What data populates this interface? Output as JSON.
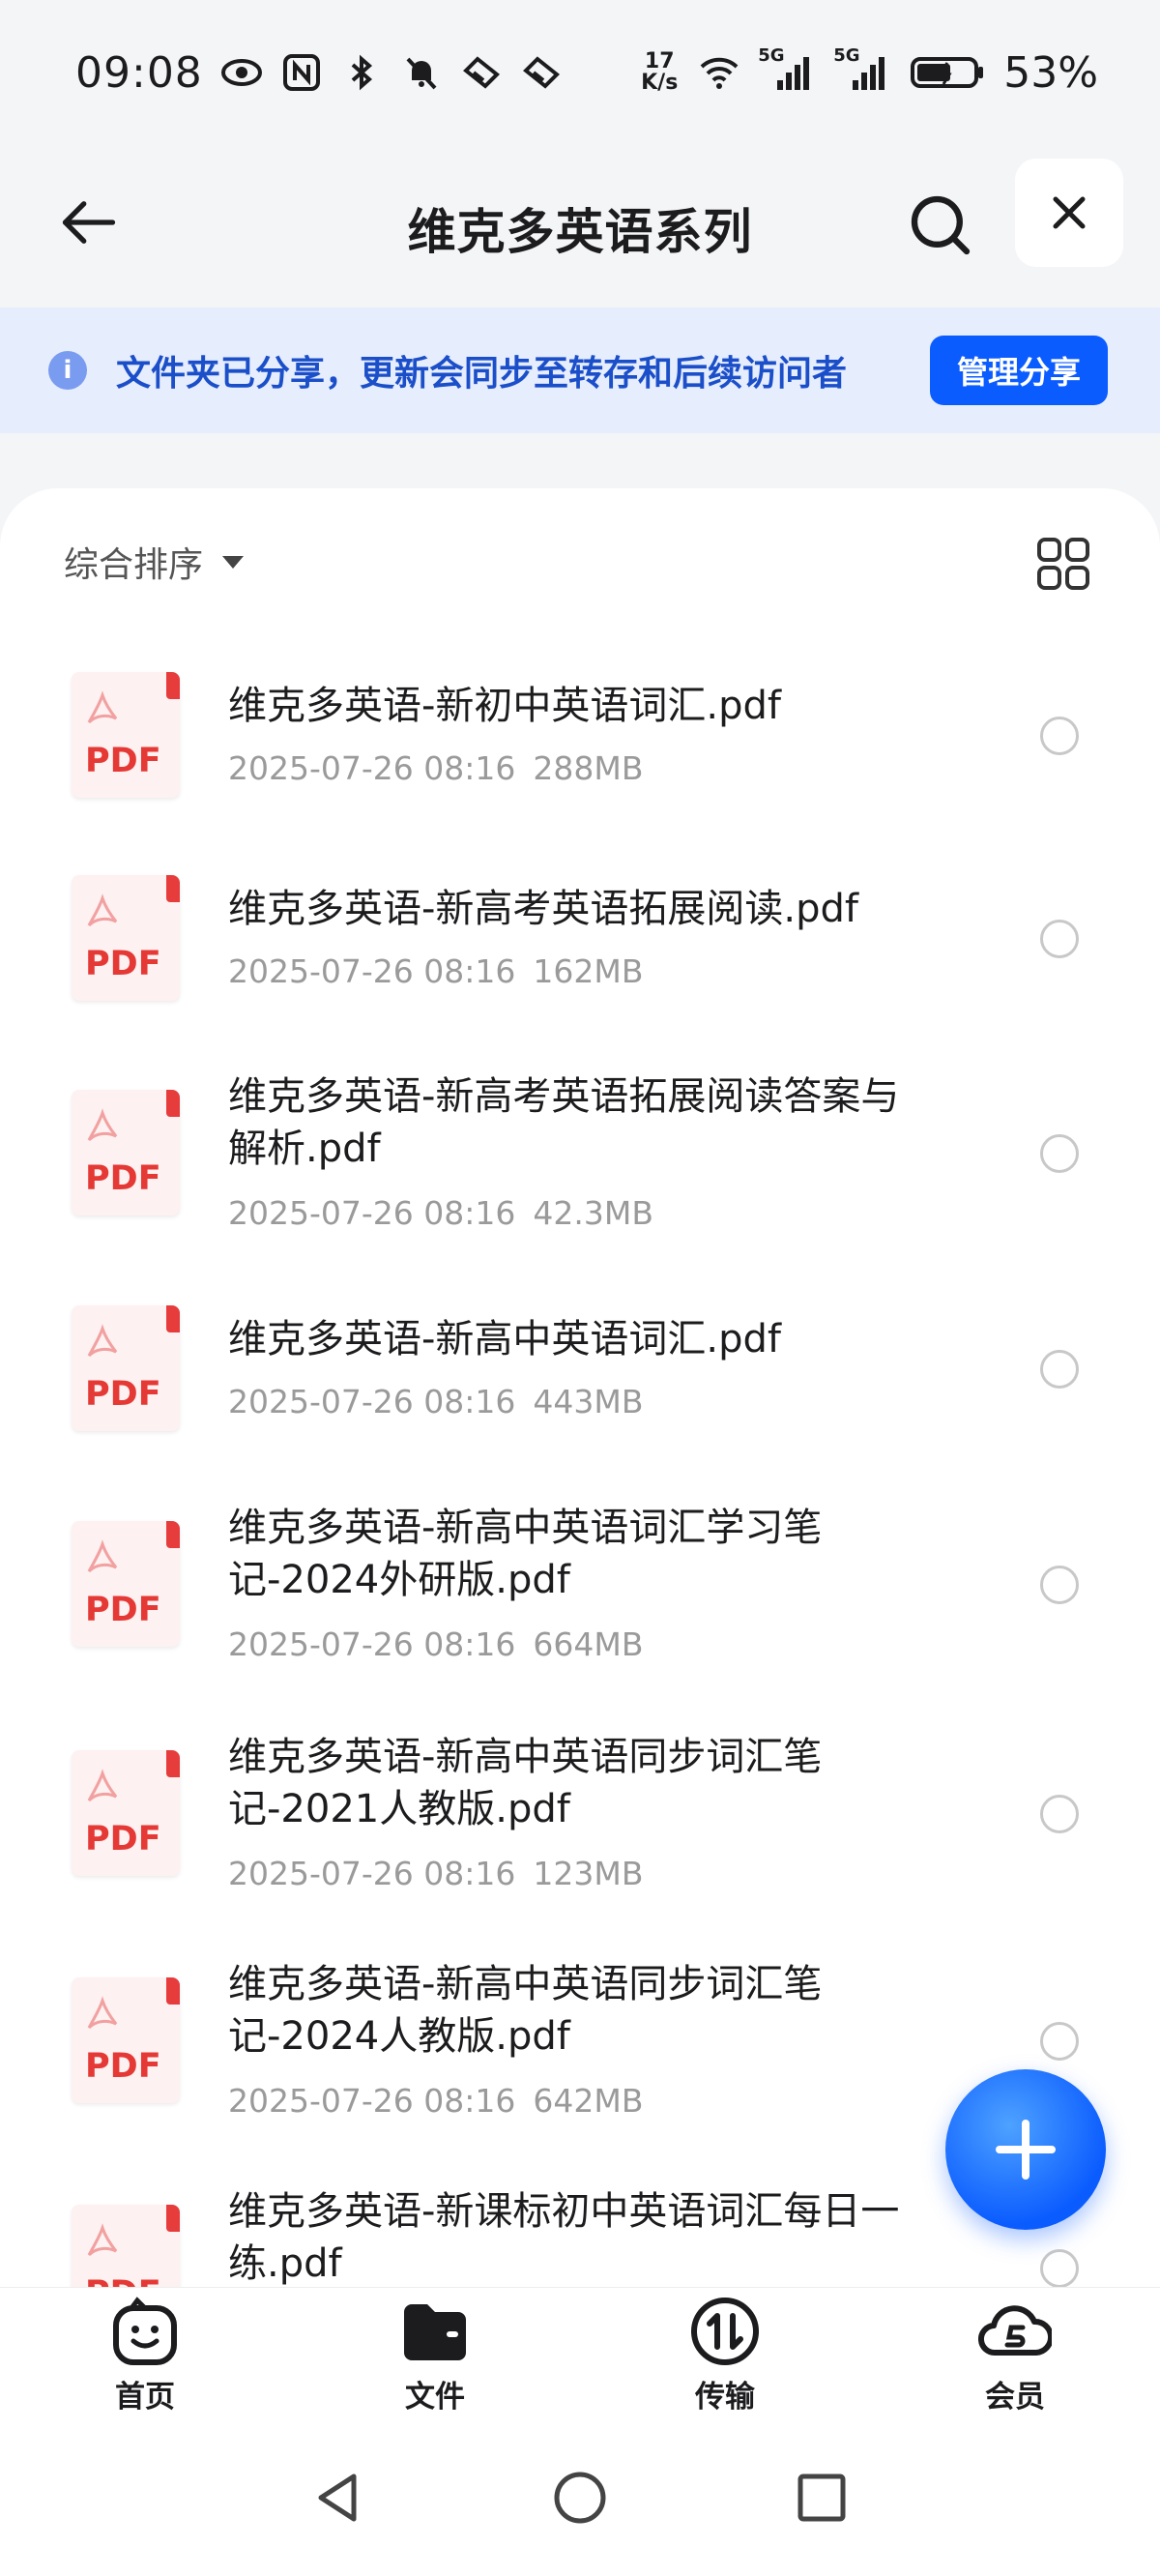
{
  "status_bar": {
    "time": "09:08",
    "net_speed_top": "17",
    "net_speed_bottom": "K/s",
    "network_1": "5G",
    "network_2": "5G",
    "battery": "53%",
    "icons": [
      "eye-icon",
      "nfc-icon",
      "bluetooth-icon",
      "mute-icon",
      "app-icon",
      "app-icon",
      "wifi-icon",
      "signal-icon",
      "battery-icon"
    ]
  },
  "header": {
    "title": "维克多英语系列"
  },
  "banner": {
    "text": "文件夹已分享，更新会同步至转存和后续访问者",
    "manage_label": "管理分享"
  },
  "sort": {
    "label": "综合排序"
  },
  "files": [
    {
      "name": "维克多英语-新初中英语词汇.pdf",
      "date": "2025-07-26 08:16",
      "size": "288MB"
    },
    {
      "name": "维克多英语-新高考英语拓展阅读.pdf",
      "date": "2025-07-26 08:16",
      "size": "162MB"
    },
    {
      "name": "维克多英语-新高考英语拓展阅读答案与解析.pdf",
      "date": "2025-07-26 08:16",
      "size": "42.3MB"
    },
    {
      "name": "维克多英语-新高中英语词汇.pdf",
      "date": "2025-07-26 08:16",
      "size": "443MB"
    },
    {
      "name": "维克多英语-新高中英语词汇学习笔记-2024外研版.pdf",
      "date": "2025-07-26 08:16",
      "size": "664MB"
    },
    {
      "name": "维克多英语-新高中英语同步词汇笔记-2021人教版.pdf",
      "date": "2025-07-26 08:16",
      "size": "123MB"
    },
    {
      "name": "维克多英语-新高中英语同步词汇笔记-2024人教版.pdf",
      "date": "2025-07-26 08:16",
      "size": "642MB"
    },
    {
      "name": "维克多英语-新课标初中英语词汇每日一练.pdf",
      "date": "",
      "size": ""
    }
  ],
  "pdf_label": "PDF",
  "bottom_nav": [
    {
      "label": "首页",
      "icon": "home-face-icon"
    },
    {
      "label": "文件",
      "icon": "folder-icon"
    },
    {
      "label": "传输",
      "icon": "transfer-icon"
    },
    {
      "label": "会员",
      "icon": "vip-cloud-icon"
    }
  ],
  "colors": {
    "accent": "#0b5cff",
    "banner_bg": "#e6edfc",
    "banner_text": "#1b4fc9",
    "pdf_red": "#e53935"
  }
}
